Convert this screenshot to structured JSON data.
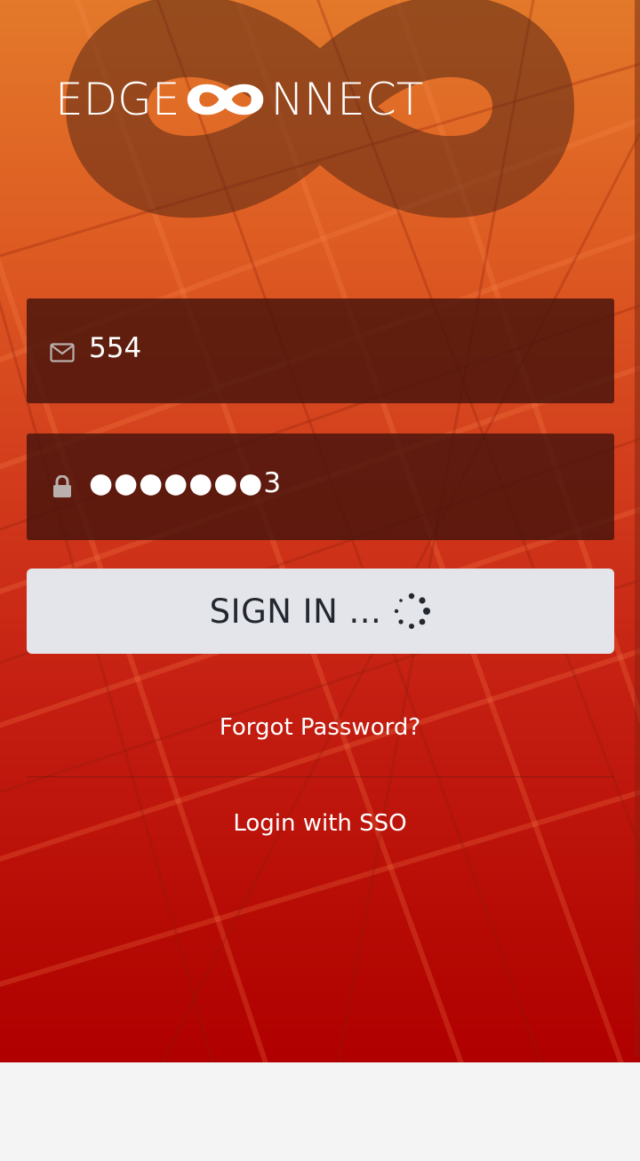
{
  "brand": {
    "logo_left": "EDGE",
    "logo_right": "NNECT",
    "logo_mark": "infinity-icon"
  },
  "form": {
    "email": {
      "icon": "envelope-icon",
      "value": "554"
    },
    "password": {
      "icon": "lock-icon",
      "value": "●●●●●●●3"
    },
    "signin_label": "SIGN IN ...",
    "spinner_icon": "spinner-icon"
  },
  "links": {
    "forgot_password": "Forgot Password?",
    "sso": "Login with SSO"
  },
  "colors": {
    "hero_top": "#e3792a",
    "hero_bottom": "#b00000",
    "field_bg": "#46140c",
    "button_bg": "#e3e5ea",
    "button_text": "#23272f",
    "page_bg": "#f4f4f4"
  }
}
